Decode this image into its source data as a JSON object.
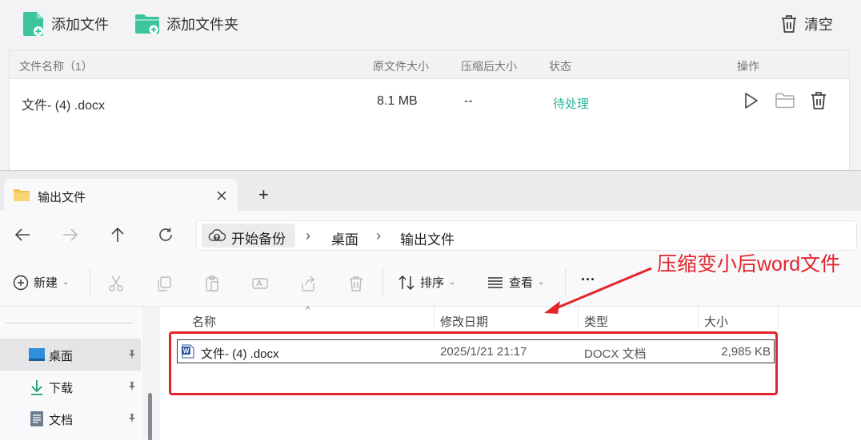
{
  "compressor": {
    "add_file": "添加文件",
    "add_folder": "添加文件夹",
    "clear": "清空",
    "columns": {
      "name": "文件名称（1）",
      "orig_size": "原文件大小",
      "comp_size": "压缩后大小",
      "status": "状态",
      "ops": "操作"
    },
    "row": {
      "name": "文件- (4) .docx",
      "orig_size": "8.1 MB",
      "comp_size": "--",
      "status": "待处理"
    },
    "colors": {
      "accent": "#2bb59a",
      "folder": "#3cc59c"
    }
  },
  "explorer": {
    "tab_title": "输出文件",
    "new_tab": "+",
    "breadcrumbs": [
      "开始备份",
      "桌面",
      "输出文件"
    ],
    "commands": {
      "new": "新建",
      "sort": "排序",
      "view": "查看",
      "more": "···"
    },
    "sidebar": [
      {
        "label": "桌面",
        "icon": "desktop-icon",
        "selected": true
      },
      {
        "label": "下载",
        "icon": "download-icon"
      },
      {
        "label": "文档",
        "icon": "document-icon"
      }
    ],
    "columns": {
      "name": "名称",
      "modified": "修改日期",
      "type": "类型",
      "size": "大小"
    },
    "file": {
      "name": "文件- (4) .docx",
      "modified": "2025/1/21 21:17",
      "type": "DOCX 文档",
      "size": "2,985 KB"
    }
  },
  "annotation": {
    "text": "压缩变小后word文件",
    "color": "#e3242b"
  }
}
